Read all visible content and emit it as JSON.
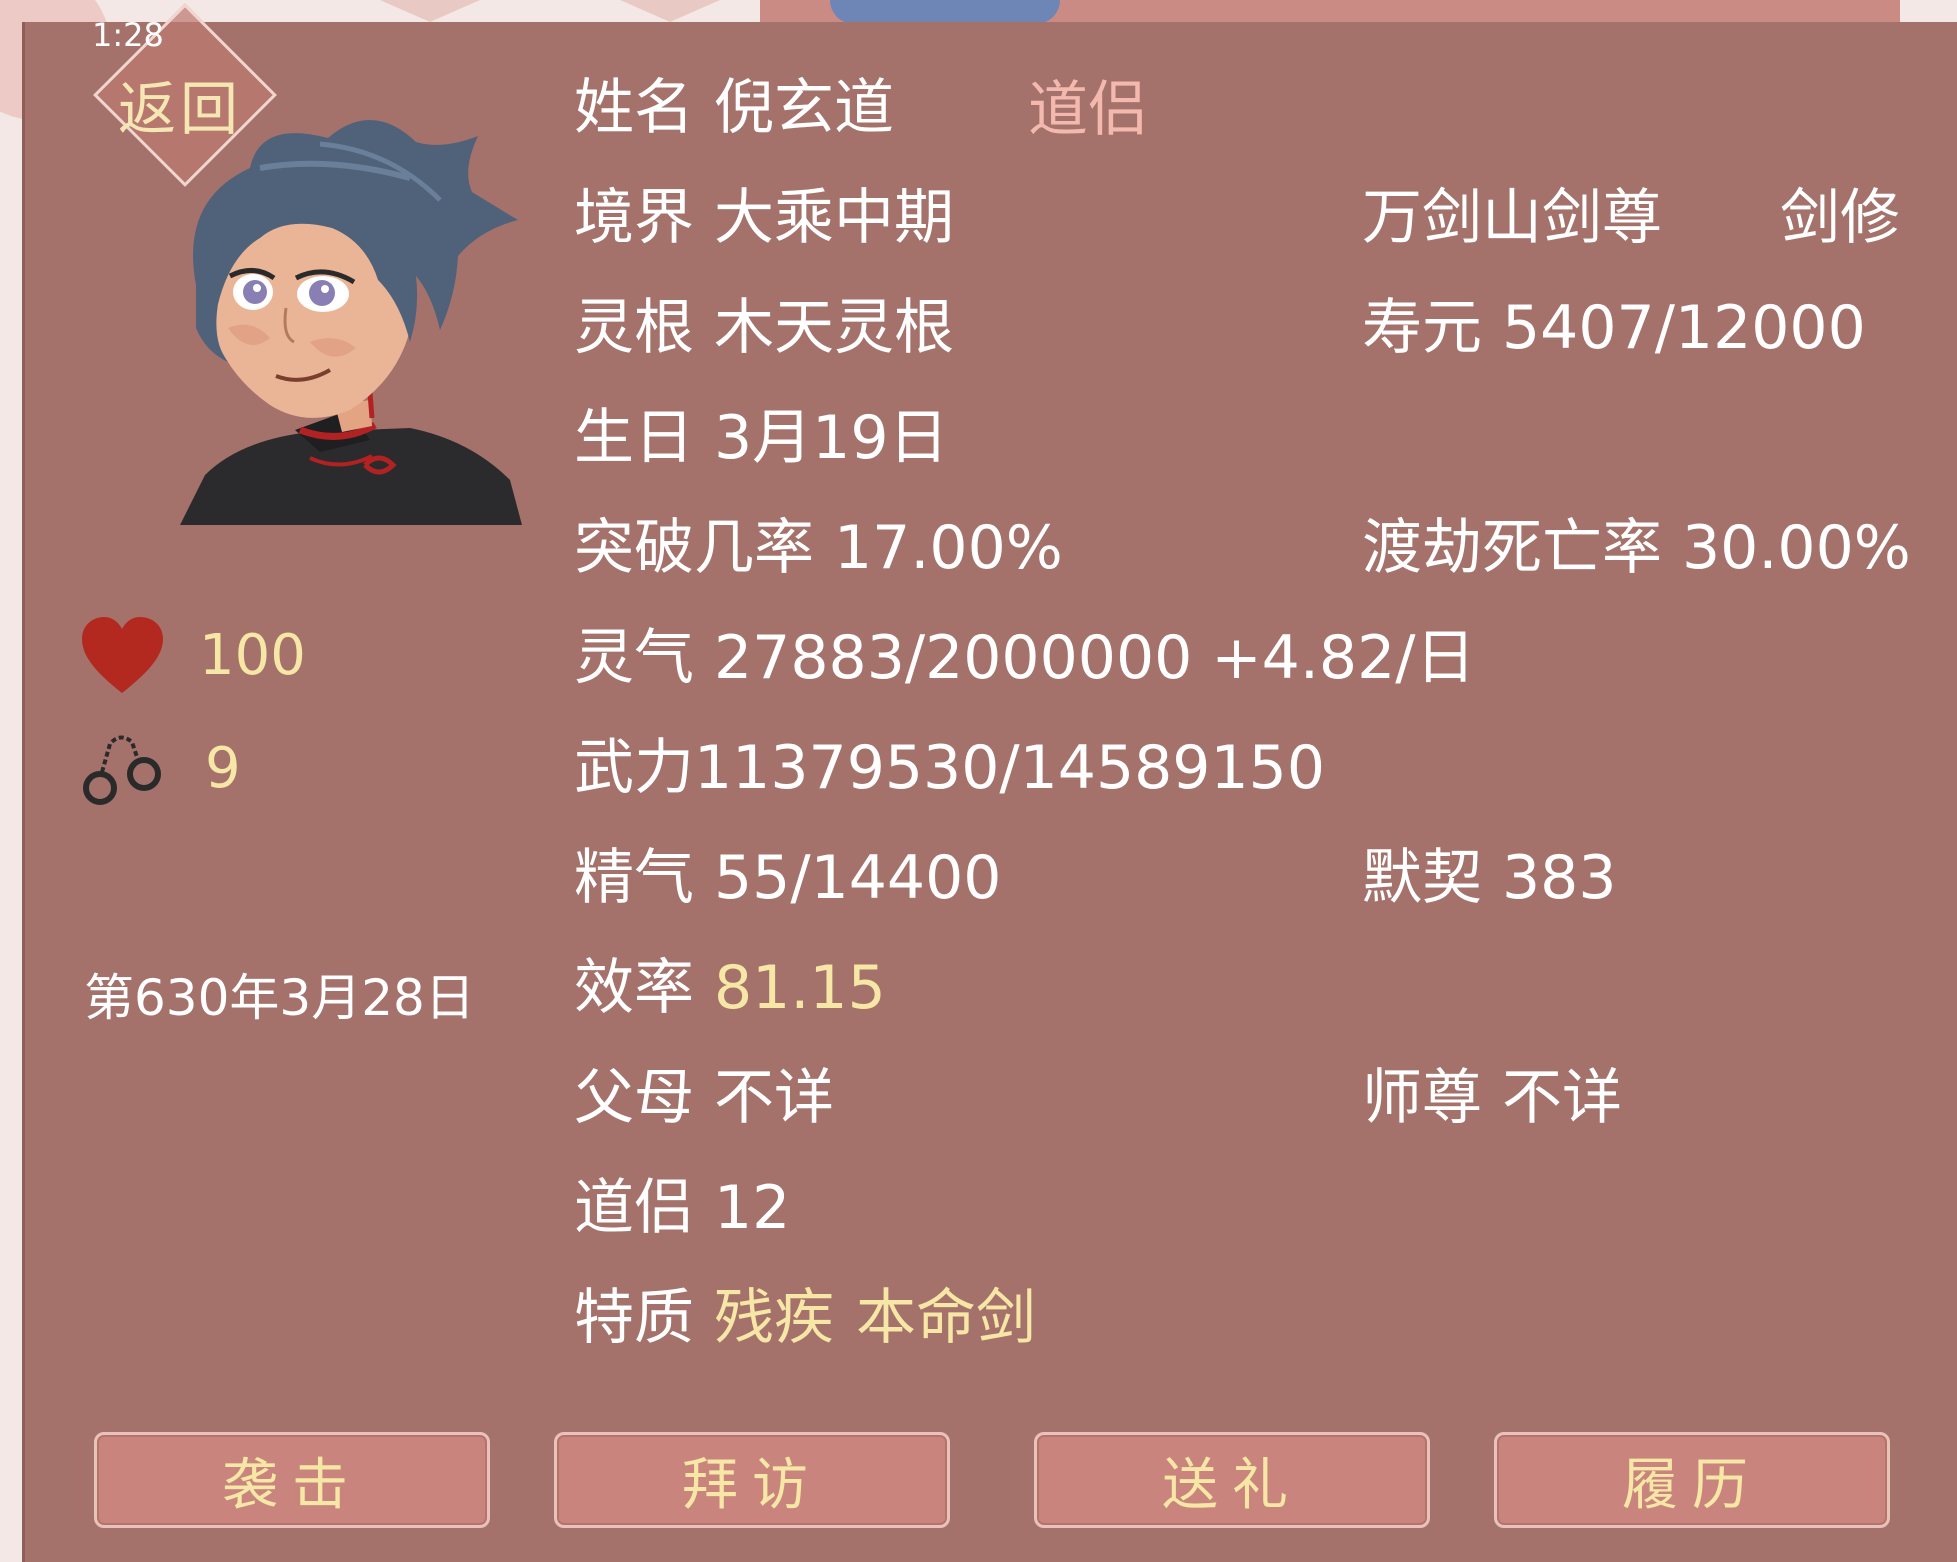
{
  "status_bar": {
    "time": "1:28"
  },
  "back_button": {
    "label": "返回"
  },
  "character": {
    "name_label": "姓名",
    "name": "倪玄道",
    "relation_tag": "道侣",
    "realm_label": "境界",
    "realm": "大乘中期",
    "title": "万剑山剑尊",
    "profession": "剑修",
    "root_label": "灵根",
    "root": "木天灵根",
    "lifespan_label": "寿元",
    "lifespan": "5407/12000",
    "birthday_label": "生日",
    "birthday": "3月19日",
    "breakthrough_label": "突破几率",
    "breakthrough": "17.00%",
    "tribulation_label": "渡劫死亡率",
    "tribulation": "30.00%",
    "qi_label": "灵气",
    "qi": "27883/2000000 +4.82/日",
    "force_text": "武力11379530/14589150",
    "essence_label": "精气",
    "essence": "55/14400",
    "rapport_label": "默契",
    "rapport": "383",
    "efficiency_label": "效率",
    "efficiency": "81.15",
    "parents_label": "父母",
    "parents": "不详",
    "master_label": "师尊",
    "master": "不详",
    "partner_label": "道侣",
    "partner": "12",
    "traits_label": "特质",
    "trait_1": "残疾",
    "trait_2": "本命剑"
  },
  "left_stats": {
    "affection": "100",
    "captivity": "9",
    "date": "第630年3月28日"
  },
  "actions": [
    "袭击",
    "拜访",
    "送礼",
    "履历"
  ],
  "icons": {
    "affection": "heart-icon",
    "captivity": "handcuffs-icon"
  },
  "colors": {
    "panel": "#a4726b",
    "highlight": "#f6e7a6",
    "tag": "#f3b9ae",
    "button": "#c9857d"
  }
}
